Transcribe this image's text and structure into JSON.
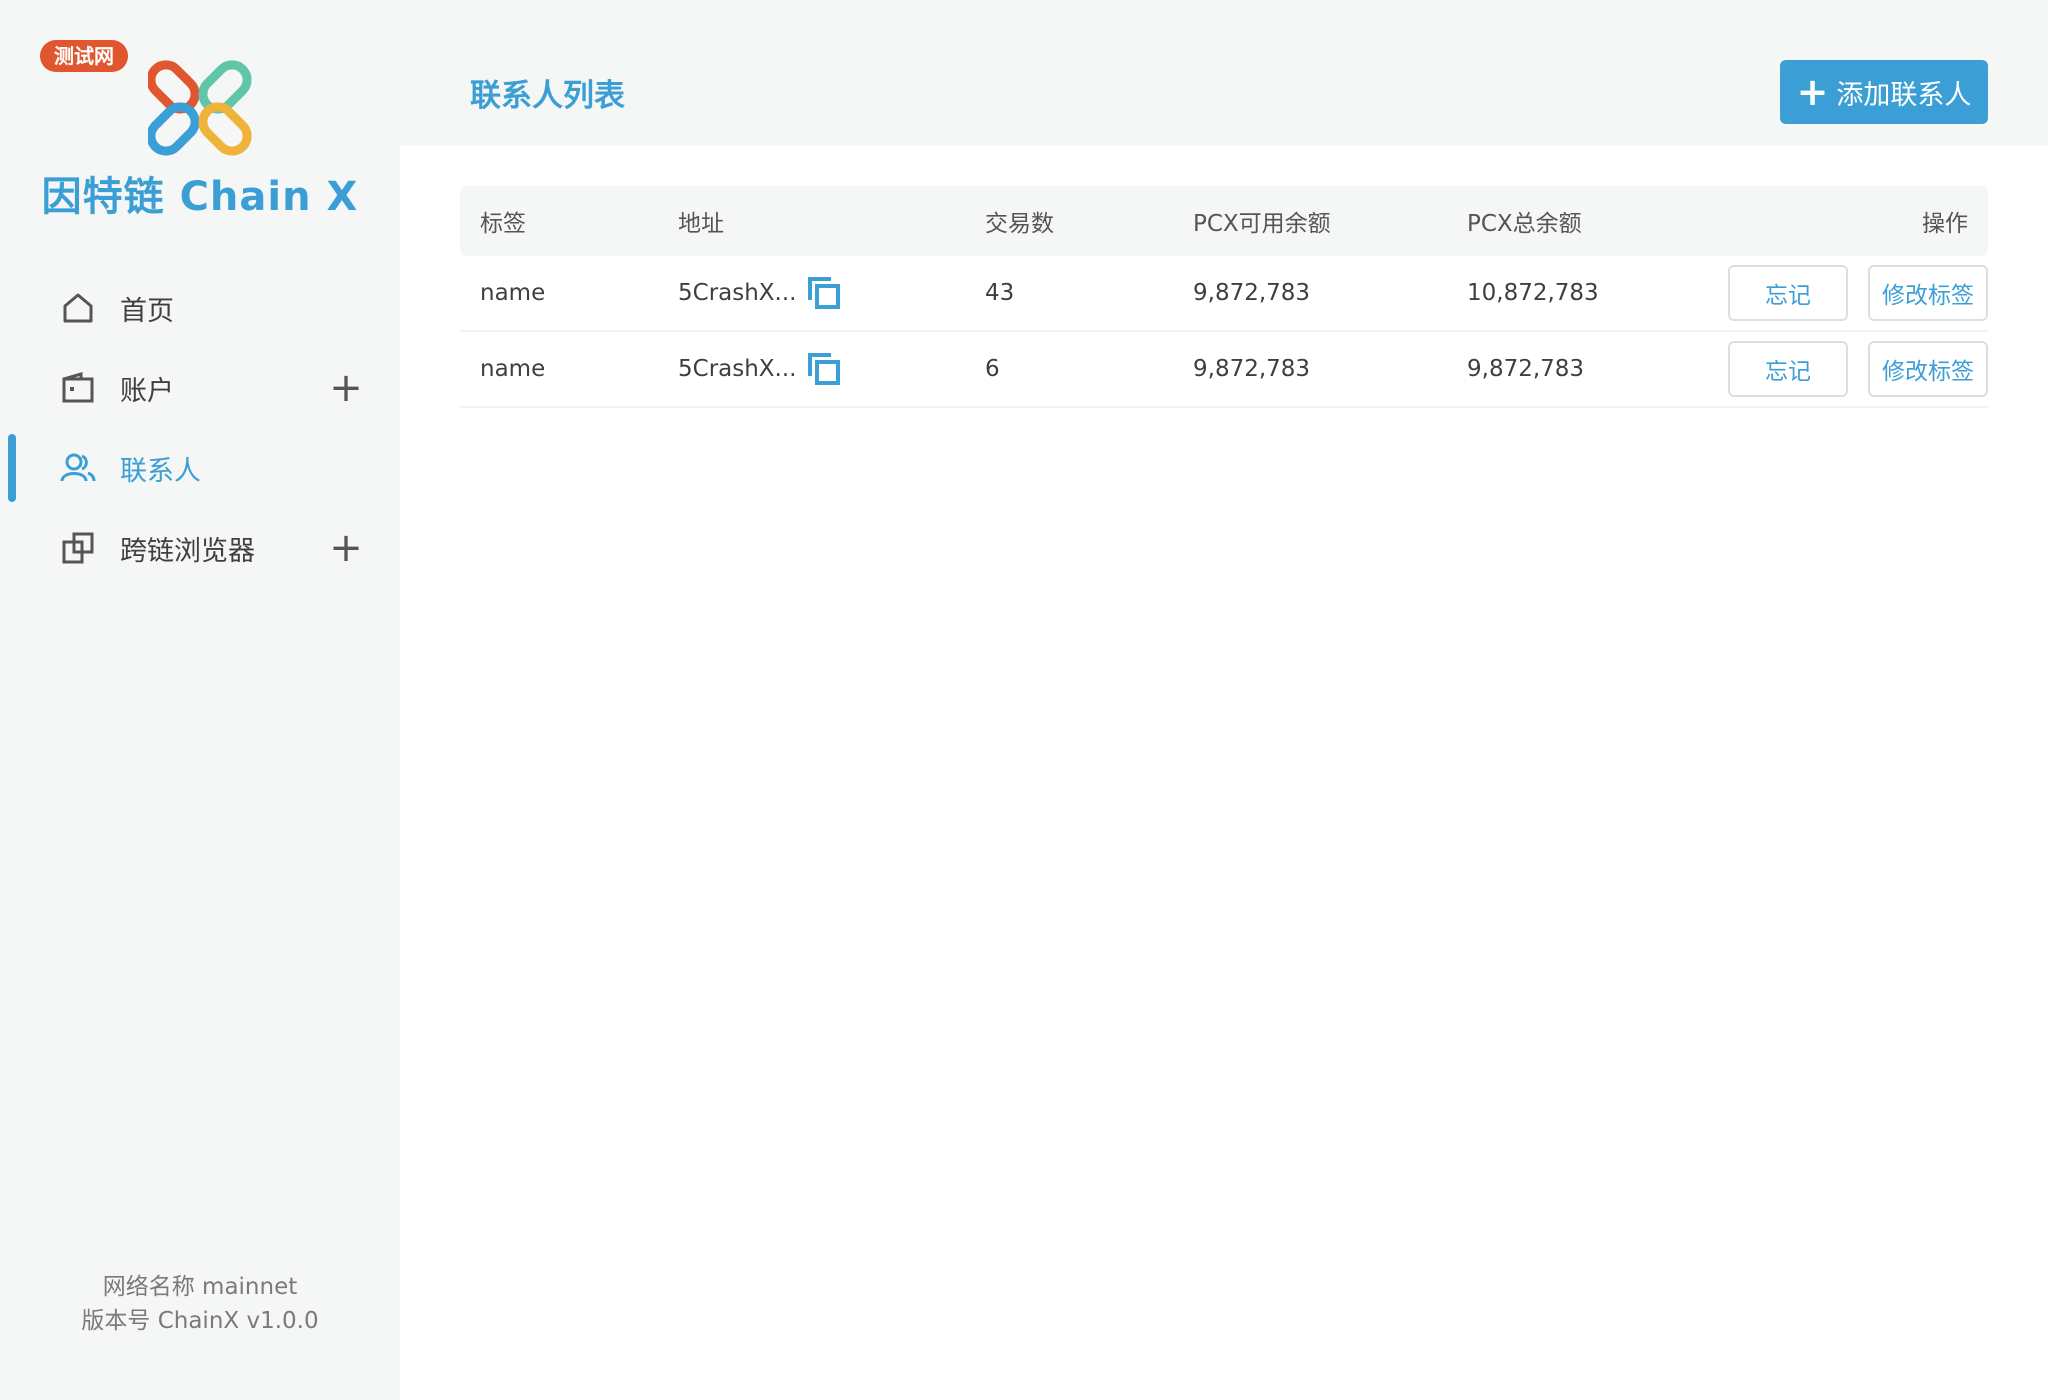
{
  "sidebar": {
    "badge": "测试网",
    "logo_text": "因特链 Chain X",
    "items": [
      {
        "label": "首页"
      },
      {
        "label": "账户"
      },
      {
        "label": "联系人"
      },
      {
        "label": "跨链浏览器"
      }
    ],
    "network_line": "网络名称 mainnet",
    "version_line": "版本号 ChainX v1.0.0"
  },
  "header": {
    "title": "联系人列表",
    "add_label": "添加联系人"
  },
  "table": {
    "columns": [
      "标签",
      "地址",
      "交易数",
      "PCX可用余额",
      "PCX总余额",
      "操作"
    ],
    "rows": [
      {
        "label": "name",
        "address": "5CrashX...",
        "tx_count": "43",
        "available": "9,872,783",
        "total": "10,872,783",
        "forget": "忘记",
        "edit": "修改标签"
      },
      {
        "label": "name",
        "address": "5CrashX...",
        "tx_count": "6",
        "available": "9,872,783",
        "total": "9,872,783",
        "forget": "忘记",
        "edit": "修改标签"
      }
    ]
  },
  "colors": {
    "accent": "#3b9fd6",
    "badge": "#e0572f",
    "sidebar_bg": "#f5f6f6"
  },
  "icons": {
    "nav": [
      "home-icon",
      "wallet-icon",
      "contacts-icon",
      "cross-chain-icon"
    ],
    "copy": "copy-icon",
    "plus": "plus-icon"
  }
}
